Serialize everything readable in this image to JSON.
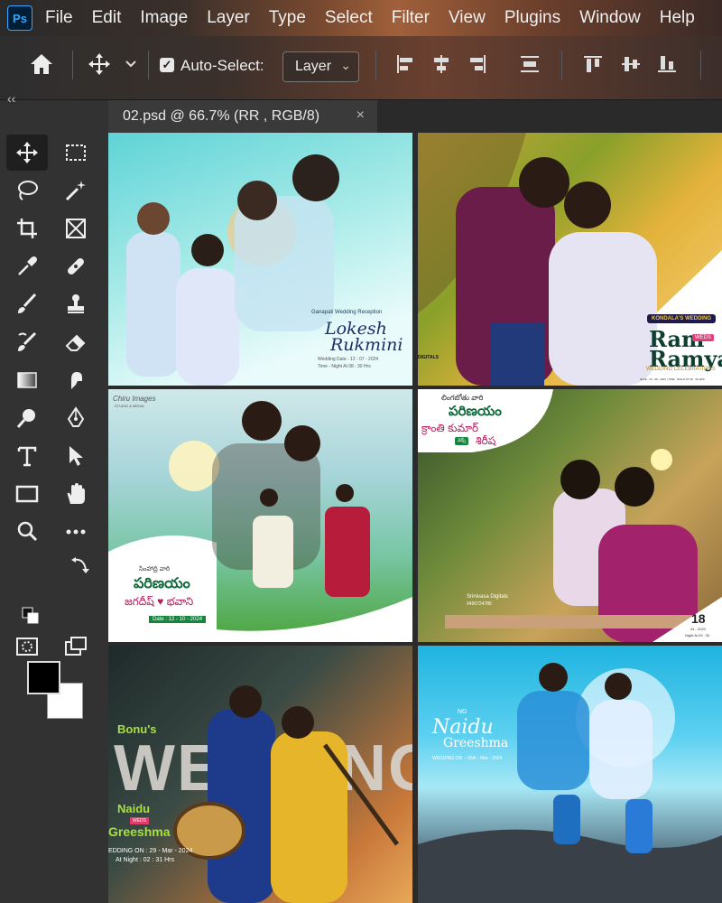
{
  "app": {
    "logo_text": "Ps"
  },
  "menu": [
    "File",
    "Edit",
    "Image",
    "Layer",
    "Type",
    "Select",
    "Filter",
    "View",
    "Plugins",
    "Window",
    "Help"
  ],
  "options_bar": {
    "auto_select_label": "Auto-Select:",
    "auto_select_checked": true,
    "target_select_value": "Layer"
  },
  "document_tab": {
    "title": "02.psd @ 66.7% (RR , RGB/8)",
    "close_symbol": "×"
  },
  "toolbox": {
    "collapse_symbol": "‹‹",
    "tools": [
      "move-tool",
      "artboard-tool",
      "lasso-tool",
      "magic-wand-tool",
      "crop-tool",
      "frame-tool",
      "eyedropper-tool",
      "healing-brush-tool",
      "brush-tool",
      "clone-stamp-tool",
      "history-brush-tool",
      "eraser-tool",
      "gradient-tool",
      "smudge-tool",
      "dodge-tool",
      "pen-tool",
      "type-tool",
      "path-selection-tool",
      "rectangle-tool",
      "hand-tool",
      "zoom-tool",
      "more-tools"
    ],
    "foreground_color": "#000000",
    "background_color": "#ffffff"
  },
  "canvas_tiles": [
    {
      "id": "tile-1",
      "texts": {
        "sub": "Ganapati Wedding Reception",
        "name1": "Lokesh",
        "name2": "Rukmini",
        "date": "Wedding Date - 12 - 07 - 2024",
        "time": "Time - Night At 08 : 30 Hrs"
      }
    },
    {
      "id": "tile-2",
      "texts": {
        "badge": "KONDALA'S WEDDING",
        "name1": "Ram",
        "weds": "WEDS",
        "name2": "Ramya",
        "sub": "WEDDING CELEBRATIONS",
        "date": "DATE : 15 - 08 - 2024 | TIME : NIGHT AT 08 : 30 HRS",
        "studio": "DIGITALS"
      }
    },
    {
      "id": "tile-3",
      "texts": {
        "logo1": "Chiru Images",
        "logo2": "STUDIO & MEDIA",
        "line1": "సింహాద్రి వారి",
        "title": "పరిణయం",
        "names": "జగదీష్ ♥ భవాని",
        "date": "Date : 12 - 10 - 2024"
      }
    },
    {
      "id": "tile-4",
      "texts": {
        "line1": "లింగబోతు వారి",
        "title": "పరిణయం",
        "groom": "క్రాంతి కుమార్",
        "weds": "వెడ్స్",
        "bride": "శిరీష",
        "studio": "Srinivasa Digitals",
        "phone": "9490724786",
        "date_day": "18",
        "date_month": "04 - 2024",
        "time": "Night At 09 : 30"
      }
    },
    {
      "id": "tile-5",
      "texts": {
        "brand": "Bonu's",
        "bg_word": "WEDDING",
        "name1": "Naidu",
        "weds": "WEDS",
        "name2": "Greeshma",
        "date": "EDDING ON : 29 - Mar - 2024",
        "time": "At Night : 02 : 31 Hrs"
      }
    },
    {
      "id": "tile-6",
      "texts": {
        "logo": "NG",
        "name1": "Naidu",
        "name2": "Greeshma",
        "date": "WEDDING ON :- 25th - Mar - 2024"
      }
    }
  ]
}
